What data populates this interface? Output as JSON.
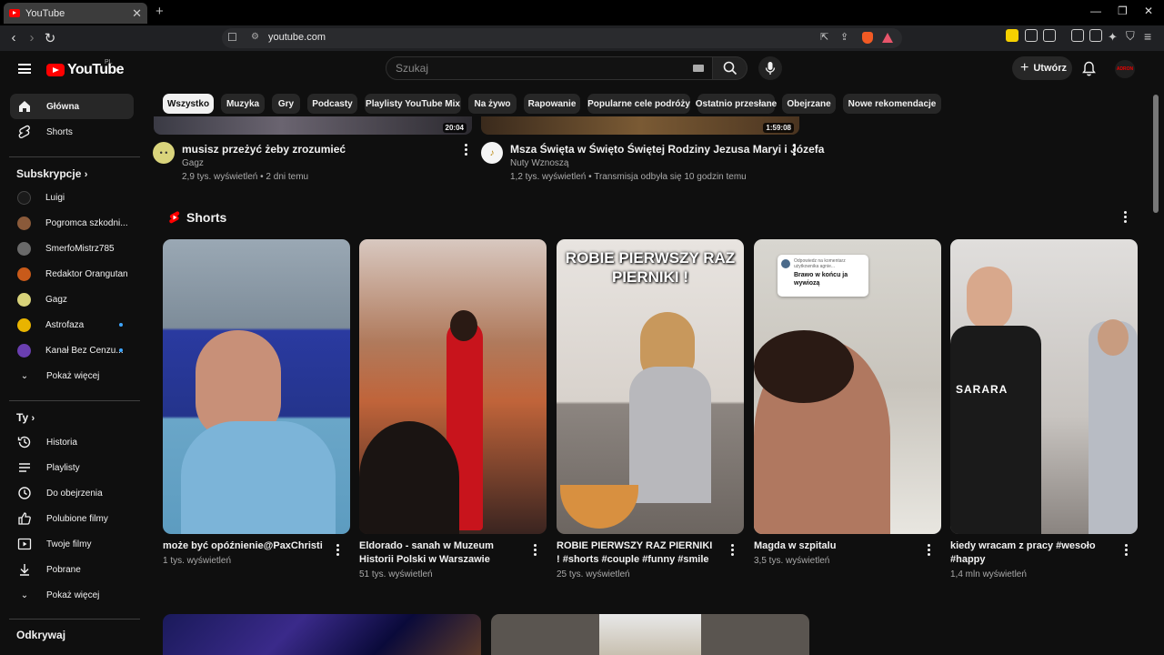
{
  "browser": {
    "tab_title": "YouTube",
    "url": "youtube.com"
  },
  "topbar": {
    "logo_text": "YouTube",
    "logo_region": "PL",
    "search_placeholder": "Szukaj",
    "create_label": "Utwórz",
    "avatar_text": "ADRON"
  },
  "sidebar": {
    "main": [
      {
        "label": "Główna",
        "icon": "home-icon"
      },
      {
        "label": "Shorts",
        "icon": "shorts-icon"
      }
    ],
    "subs_header": "Subskrypcje",
    "subscriptions": [
      {
        "label": "Luigi",
        "color": "#1a1a1a",
        "new": false
      },
      {
        "label": "Pogromca szkodni...",
        "color": "#8a5a3a",
        "new": false
      },
      {
        "label": "SmerfoMistrz785",
        "color": "#6a6a6a",
        "new": false
      },
      {
        "label": "Redaktor Orangutan",
        "color": "#c85a1a",
        "new": false
      },
      {
        "label": "Gagz",
        "color": "#d8d27a",
        "new": false
      },
      {
        "label": "Astrofaza",
        "color": "#e8b400",
        "new": true
      },
      {
        "label": "Kanał Bez Cenzu...",
        "color": "#6a3fb0",
        "new": true
      }
    ],
    "show_more": "Pokaż więcej",
    "you_header": "Ty",
    "you_items": [
      {
        "label": "Historia",
        "icon": "history-icon"
      },
      {
        "label": "Playlisty",
        "icon": "playlist-icon"
      },
      {
        "label": "Do obejrzenia",
        "icon": "clock-icon"
      },
      {
        "label": "Polubione filmy",
        "icon": "thumbs-up-icon"
      },
      {
        "label": "Twoje filmy",
        "icon": "video-icon"
      },
      {
        "label": "Pobrane",
        "icon": "download-icon"
      }
    ],
    "show_more_2": "Pokaż więcej",
    "explore_header": "Odkrywaj"
  },
  "chips": [
    "Wszystko",
    "Muzyka",
    "Gry",
    "Podcasty",
    "Playlisty YouTube Mix",
    "Na żywo",
    "Rapowanie",
    "Popularne cele podróży",
    "Ostatnio przesłane",
    "Obejrzane",
    "Nowe rekomendacje"
  ],
  "videos": [
    {
      "duration": "20:04",
      "title": "musisz przeżyć żeby zrozumieć",
      "channel": "Gagz",
      "meta": "2,9 tys. wyświetleń • 2 dni temu"
    },
    {
      "duration": "1:59:08",
      "title": "Msza Święta w Święto Świętej Rodziny Jezusa Maryi i Józefa",
      "channel": "Nuty Wznoszą",
      "meta": "1,2 tys. wyświetleń • Transmisja odbyła się 10 godzin temu"
    }
  ],
  "shorts_header": "Shorts",
  "shorts": [
    {
      "title": "może być opóźnienie@PaxChristi",
      "views": "1 tys. wyświetleń"
    },
    {
      "title": "Eldorado - sanah w Muzeum Historii Polski w Warszawie",
      "views": "51 tys. wyświetleń"
    },
    {
      "title": "ROBIE PIERWSZY RAZ PIERNIKI ! #shorts #couple #funny #smile ...",
      "views": "25 tys. wyświetleń",
      "overlay": "ROBIE PIERWSZY RAZ PIERNIKI !"
    },
    {
      "title": "Magda w szpitalu",
      "views": "3,5 tys. wyświetleń",
      "bubble_small": "Odpowiedz na komentarz użytkownika agnie...",
      "bubble": "Brawo w końcu ja wywiozą"
    },
    {
      "title": "kiedy wracam z pracy #wesoło #happy",
      "views": "1,4 mln wyświetleń",
      "shirt": "SARARA"
    }
  ]
}
